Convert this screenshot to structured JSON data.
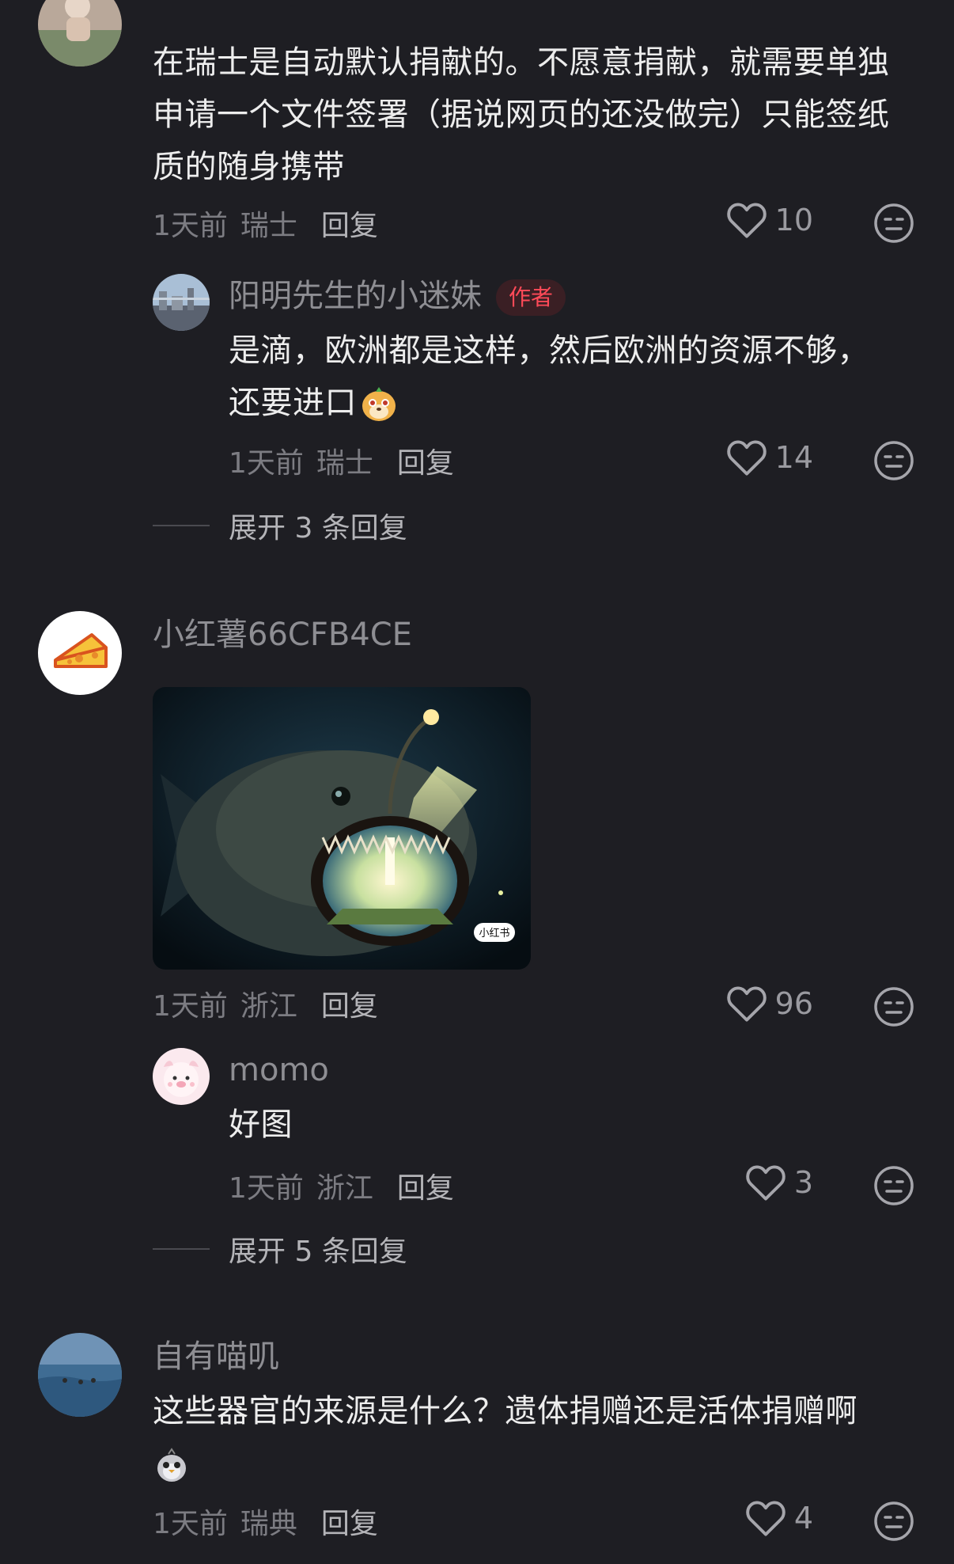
{
  "colors": {
    "background": "#1e1e23",
    "text_primary": "#ededed",
    "text_secondary": "#8e8e93",
    "author_tag": "#ff4a58"
  },
  "comments": [
    {
      "avatar_icon": "user-photo-avatar",
      "text": "在瑞士是自动默认捐献的。不愿意捐献，就需要单独申请一个文件签署（据说网页的还没做完）只能签纸质的随身携带",
      "time": "1天前",
      "location": "瑞士",
      "reply_label": "回复",
      "likes": "10",
      "replies": [
        {
          "nickname": "阳明先生的小迷妹",
          "tag": "作者",
          "text": "是滴，欧洲都是这样，然后欧洲的资源不够，还要进口",
          "emoji_icon": "dog-emoji",
          "time": "1天前",
          "location": "瑞士",
          "reply_label": "回复",
          "likes": "14"
        }
      ],
      "expand_label": "展开 3 条回复"
    },
    {
      "nickname": "小红薯66CFB4CE",
      "avatar_icon": "cheese-avatar",
      "image_alt": "anglerfish-image",
      "image_watermark": "小红书",
      "time": "1天前",
      "location": "浙江",
      "reply_label": "回复",
      "likes": "96",
      "replies": [
        {
          "nickname": "momo",
          "text": "好图",
          "time": "1天前",
          "location": "浙江",
          "reply_label": "回复",
          "likes": "3"
        }
      ],
      "expand_label": "展开 5 条回复"
    },
    {
      "nickname": "自有喵叽",
      "avatar_icon": "seascape-avatar",
      "text": "这些器官的来源是什么？遗体捐赠还是活体捐赠啊",
      "emoji_icon": "sad-bird-emoji",
      "time": "1天前",
      "location": "瑞典",
      "reply_label": "回复",
      "likes": "4"
    }
  ]
}
